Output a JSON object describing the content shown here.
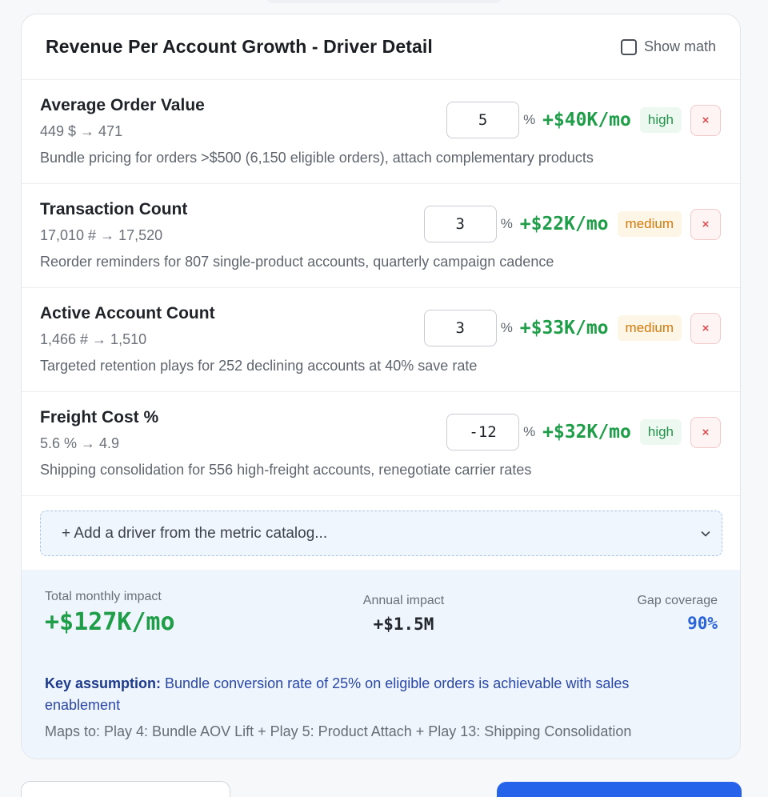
{
  "header": {
    "title": "Revenue Per Account Growth - Driver Detail",
    "show_math_label": "Show math"
  },
  "drivers": [
    {
      "name": "Average Order Value",
      "range": "449 $ → 471",
      "description": "Bundle pricing for orders >$500 (6,150 eligible orders), attach complementary products",
      "pct": "5",
      "pct_sign": "%",
      "impact": "+$40K/mo",
      "confidence": "high",
      "remove": "×"
    },
    {
      "name": "Transaction Count",
      "range": "17,010 # → 17,520",
      "description": "Reorder reminders for 807 single-product accounts, quarterly campaign cadence",
      "pct": "3",
      "pct_sign": "%",
      "impact": "+$22K/mo",
      "confidence": "medium",
      "remove": "×"
    },
    {
      "name": "Active Account Count",
      "range": "1,466 # → 1,510",
      "description": "Targeted retention plays for 252 declining accounts at 40% save rate",
      "pct": "3",
      "pct_sign": "%",
      "impact": "+$33K/mo",
      "confidence": "medium",
      "remove": "×"
    },
    {
      "name": "Freight Cost %",
      "range": "5.6 % → 4.9",
      "description": "Shipping consolidation for 556 high-freight accounts, renegotiate carrier rates",
      "pct": "-12",
      "pct_sign": "%",
      "impact": "+$32K/mo",
      "confidence": "high",
      "remove": "×"
    }
  ],
  "add_driver": {
    "label": "+ Add a driver from the metric catalog...",
    "icon": "chevron-down-icon"
  },
  "summary": {
    "total_label": "Total monthly impact",
    "total_value": "+$127K/mo",
    "annual_label": "Annual impact",
    "annual_value": "+$1.5M",
    "gap_label": "Gap coverage",
    "gap_value": "90%",
    "assumption_label": "Key assumption:",
    "assumption_text": " Bundle conversion rate of 25% on eligible orders is achievable with sales enablement",
    "maps_to": "Maps to: Play 4: Bundle AOV Lift + Play 5: Product Attach + Play 13: Shipping Consolidation"
  },
  "colors": {
    "impact_green": "#1f9d48",
    "accent_blue": "#2563eb",
    "medium_orange": "#d27a0c",
    "remove_red": "#e05050"
  }
}
